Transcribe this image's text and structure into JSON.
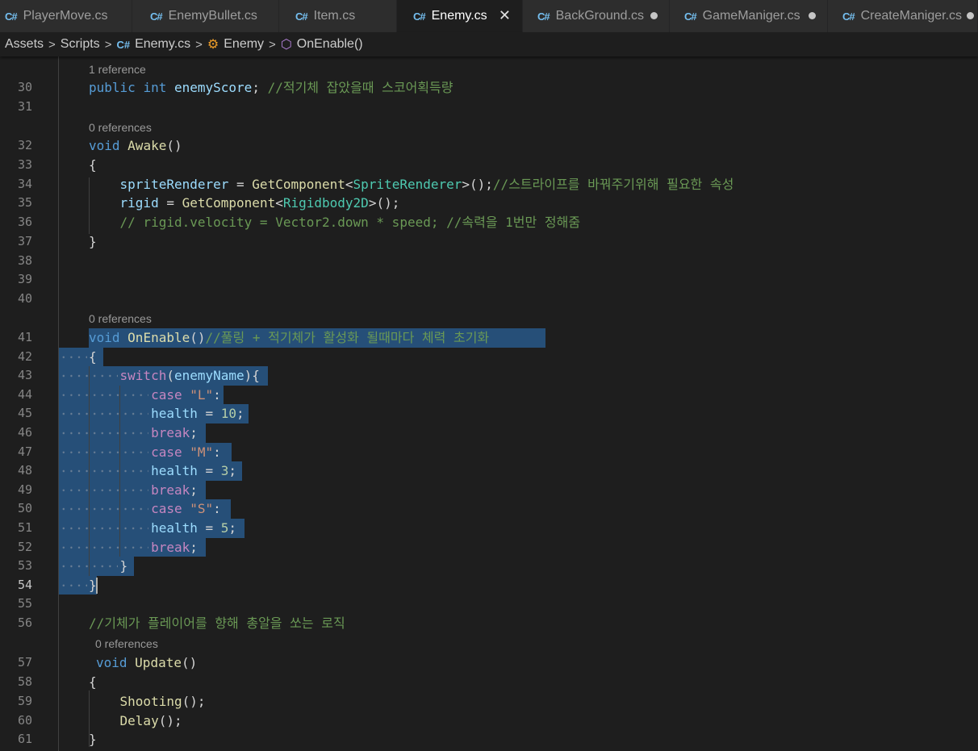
{
  "tabs": [
    {
      "label": "PlayerMove.cs",
      "icon": "C#",
      "active": false,
      "dirty": false
    },
    {
      "label": "EnemyBullet.cs",
      "icon": "C#",
      "active": false,
      "dirty": false
    },
    {
      "label": "Item.cs",
      "icon": "C#",
      "active": false,
      "dirty": false
    },
    {
      "label": "Enemy.cs",
      "icon": "C#",
      "active": true,
      "dirty": false
    },
    {
      "label": "BackGround.cs",
      "icon": "C#",
      "active": false,
      "dirty": true
    },
    {
      "label": "GameManiger.cs",
      "icon": "C#",
      "active": false,
      "dirty": true
    },
    {
      "label": "CreateManiger.cs",
      "icon": "C#",
      "active": false,
      "dirty": true
    }
  ],
  "breadcrumb": {
    "items": [
      "Assets",
      "Scripts",
      "Enemy.cs",
      "Enemy",
      "OnEnable()"
    ],
    "separator": ">"
  },
  "editor": {
    "lens_lines": {
      "r30": "1 reference",
      "r32": "0 references",
      "r41": "0 references",
      "r57": "0 references"
    },
    "line_numbers": [
      "30",
      "31",
      "32",
      "33",
      "34",
      "35",
      "36",
      "37",
      "38",
      "39",
      "40",
      "41",
      "42",
      "43",
      "44",
      "45",
      "46",
      "47",
      "48",
      "49",
      "50",
      "51",
      "52",
      "53",
      "54",
      "55",
      "56",
      "57",
      "58",
      "59",
      "60",
      "61"
    ],
    "code": {
      "l30_kw1": "public",
      "l30_kw2": "int",
      "l30_var": "enemyScore",
      "l30_cm": "//적기체 잡았을때 스코어획득량",
      "l32_kw": "void",
      "l32_fn": "Awake",
      "l34_var": "spriteRenderer",
      "l34_fn": "GetComponent",
      "l34_ty": "SpriteRenderer",
      "l34_cm": "//스트라이프를 바꿔주기위해 필요한 속성",
      "l35_var": "rigid",
      "l35_fn": "GetComponent",
      "l35_ty": "Rigidbody2D",
      "l36_cm": "// rigid.velocity = Vector2.down * speed; //속력을 1번만 정해줌",
      "l41_kw": "void",
      "l41_fn": "OnEnable",
      "l41_cm": "//풀링 + 적기체가 활성화 될때마다 체력 초기화",
      "l43_ctl": "switch",
      "l43_var": "enemyName",
      "l44_ctl": "case",
      "l44_str": "\"L\"",
      "l45_var": "health",
      "l45_num": "10",
      "l46_ctl": "break",
      "l47_ctl": "case",
      "l47_str": "\"M\"",
      "l48_var": "health",
      "l48_num": "3",
      "l49_ctl": "break",
      "l50_ctl": "case",
      "l50_str": "\"S\"",
      "l51_var": "health",
      "l51_num": "5",
      "l52_ctl": "break",
      "l56_cm": "//기체가 플레이어를 향해 총알을 쏘는 로직",
      "l57_kw": "void",
      "l57_fn": "Update",
      "l59_fn": "Shooting",
      "l60_fn": "Delay"
    },
    "current_line": "54"
  },
  "colors": {
    "background": "#1e1e1e",
    "selection": "#264f78",
    "keyword": "#569cd6",
    "control": "#c586c0",
    "type": "#4ec9b0",
    "function": "#dcdcaa",
    "variable": "#9cdcfe",
    "string": "#ce9178",
    "number": "#b5cea8",
    "comment": "#6a9955"
  }
}
